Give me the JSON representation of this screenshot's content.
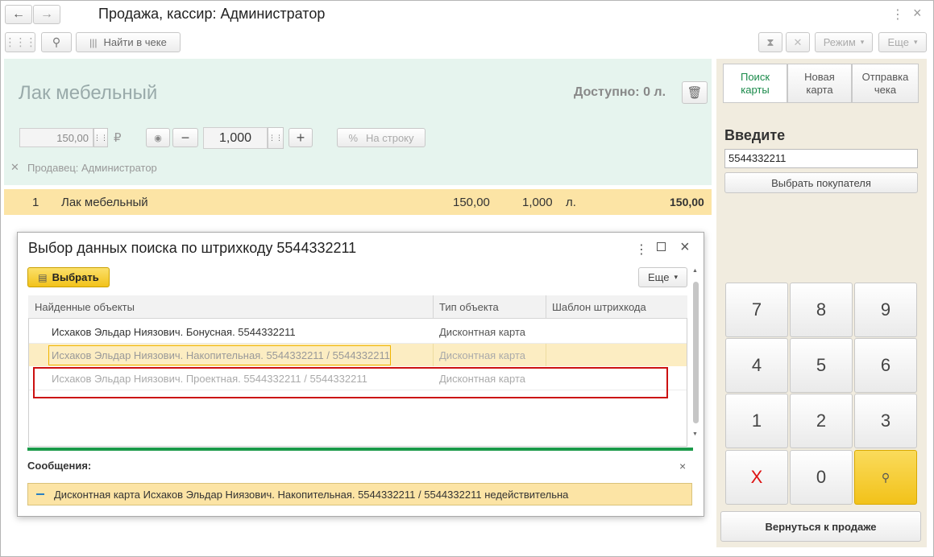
{
  "window": {
    "title": "Продажа, кассир: Администратор"
  },
  "toolbar": {
    "find_in_receipt": "Найти в чеке",
    "mode": "Режим",
    "more": "Еще"
  },
  "product": {
    "name": "Лак мебельный",
    "available": "Доступно: 0 л.",
    "price": "150,00",
    "currency": "₽",
    "quantity": "1,000",
    "to_line": "На строку",
    "seller": "Продавец: Администратор"
  },
  "receipt_row": {
    "num": "1",
    "name": "Лак мебельный",
    "price": "150,00",
    "qty": "1,000",
    "unit": "л.",
    "sum": "150,00"
  },
  "right_panel": {
    "tabs": [
      "Поиск\nкарты",
      "Новая\nкарта",
      "Отправка\nчека"
    ],
    "enter_label": "Введите",
    "input_value": "5544332211",
    "choose_buyer": "Выбрать покупателя",
    "keys": [
      "7",
      "8",
      "9",
      "4",
      "5",
      "6",
      "1",
      "2",
      "3",
      "X",
      "0"
    ],
    "back_to_sale": "Вернуться к продаже"
  },
  "dialog": {
    "title": "Выбор данных поиска по штрихкоду 5544332211",
    "select_button": "Выбрать",
    "more": "Еще",
    "columns": [
      "Найденные объекты",
      "Тип объекта",
      "Шаблон штрихкода"
    ],
    "rows": [
      {
        "object": "Исхаков Эльдар Ниязович. Бонусная. 5544332211",
        "type": "Дисконтная карта",
        "template": ""
      },
      {
        "object": "Исхаков Эльдар Ниязович. Накопительная. 5544332211 / 5544332211",
        "type": "Дисконтная карта",
        "template": ""
      },
      {
        "object": "Исхаков Эльдар Ниязович. Проектная. 5544332211 / 5544332211",
        "type": "Дисконтная карта",
        "template": ""
      }
    ],
    "messages_label": "Сообщения:",
    "message": "Дисконтная карта Исхаков Эльдар Ниязович. Накопительная. 5544332211 / 5544332211 недействительна"
  },
  "colors": {
    "accent_yellow": "#f5c518",
    "highlight_row": "#fce4a5",
    "green_panel": "#e6f4ee",
    "red_outline": "#cc1111",
    "progress_green": "#1a9a4a"
  }
}
